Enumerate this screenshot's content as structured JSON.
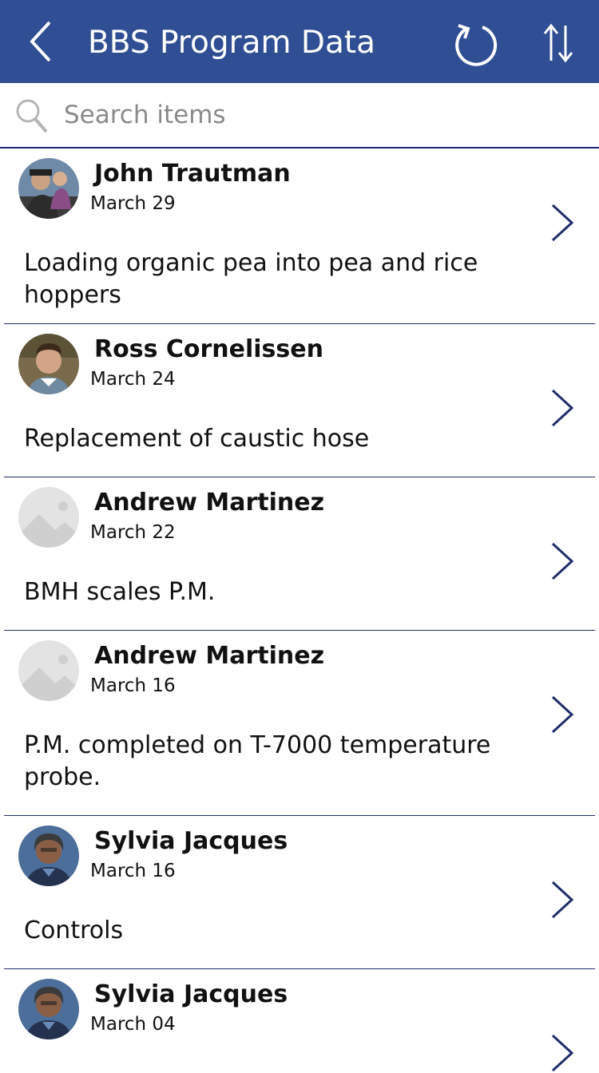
{
  "header": {
    "title": "BBS Program Data",
    "back_icon": "chevron-left-icon",
    "refresh_icon": "refresh-icon",
    "sort_icon": "sort-icon"
  },
  "search": {
    "placeholder": "Search items",
    "value": ""
  },
  "items": [
    {
      "name": "John Trautman",
      "date": "March 29",
      "description": "Loading organic pea into pea and rice hoppers",
      "avatar": "photo"
    },
    {
      "name": "Ross Cornelissen",
      "date": "March 24",
      "description": "Replacement of caustic hose",
      "avatar": "photo"
    },
    {
      "name": "Andrew Martinez",
      "date": "March 22",
      "description": "BMH scales P.M.",
      "avatar": "placeholder-image-icon"
    },
    {
      "name": "Andrew Martinez",
      "date": "March 16",
      "description": "P.M. completed on T-7000 temperature probe.",
      "avatar": "placeholder-image-icon"
    },
    {
      "name": "Sylvia Jacques",
      "date": "March 16",
      "description": "Controls",
      "avatar": "photo"
    },
    {
      "name": "Sylvia Jacques",
      "date": "March 04",
      "description": "",
      "avatar": "photo"
    }
  ],
  "colors": {
    "header_bg": "#2f4e93",
    "divider": "#1f2e6b",
    "chevron": "#1f2e6b"
  }
}
